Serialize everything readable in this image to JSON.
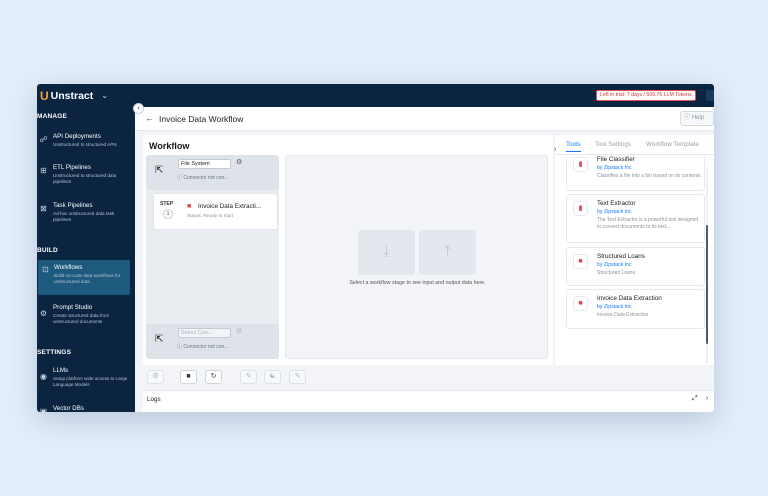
{
  "app": {
    "name": "Unstract",
    "trial_text": "Left in trial: 7 days / 506.76 LLM Tokens"
  },
  "sidebar": {
    "sections": [
      {
        "heading": "MANAGE",
        "items": [
          {
            "label": "API Deployments",
            "sub": "Unstructured to structured APIs",
            "icon": "api-icon"
          },
          {
            "label": "ETL Pipelines",
            "sub": "Unstructured to structured data pipelines",
            "icon": "pipeline-icon"
          },
          {
            "label": "Task Pipelines",
            "sub": "Ad-hoc unstructured data task pipelines",
            "icon": "task-icon"
          }
        ]
      },
      {
        "heading": "BUILD",
        "items": [
          {
            "label": "Workflows",
            "sub": "Build no-code data workflows for unstructured data",
            "icon": "workflow-icon",
            "active": true
          },
          {
            "label": "Prompt Studio",
            "sub": "Create structured data from unstructured documents",
            "icon": "prompt-icon"
          }
        ]
      },
      {
        "heading": "SETTINGS",
        "items": [
          {
            "label": "LLMs",
            "sub": "Setup platform wide access to Large Language Models",
            "icon": "llm-icon"
          },
          {
            "label": "Vector DBs",
            "sub": "",
            "icon": "vector-icon"
          }
        ]
      }
    ]
  },
  "header": {
    "title": "Invoice Data Workflow",
    "help_label": "Help"
  },
  "workflow": {
    "title": "Workflow",
    "source": {
      "selected": "File System",
      "note": "Connector not con..."
    },
    "step": {
      "label": "STEP",
      "number": "1",
      "title": "Invoice Data Extracti...",
      "status": "Status: Ready to start"
    },
    "destination": {
      "placeholder": "Select Con...",
      "note": "Connector not con..."
    },
    "stage_text": "Select a workflow stage to see input and output data here."
  },
  "tools_panel": {
    "tabs": [
      "Tools",
      "Tool Settings",
      "Workflow Template"
    ],
    "active_tab": "Tools",
    "tools": [
      {
        "title": "File Classifier",
        "by": "by Zipstack Inc",
        "desc": "Classifies a file into a bin based on its contents",
        "icon": "folder-icon"
      },
      {
        "title": "Text Extractor",
        "by": "by Zipstack Inc",
        "desc": "The Text Extractor is a powerful tool designed to convert documents to its text...",
        "icon": "folder-icon"
      },
      {
        "title": "Structured Loans",
        "by": "by Zipstack Inc",
        "desc": "Structured Loans",
        "icon": "robot-icon"
      },
      {
        "title": "Invoice Data Extraction",
        "by": "by Zipstack Inc",
        "desc": "Invoice Data Extraction",
        "icon": "robot-icon"
      }
    ]
  },
  "logs": {
    "label": "Logs"
  },
  "colors": {
    "nav_bg": "#0b2540",
    "active_item": "#1e5a7e",
    "accent": "#1677ff",
    "brand_orange": "#f0a43a",
    "tool_icon": "#e0414f"
  }
}
